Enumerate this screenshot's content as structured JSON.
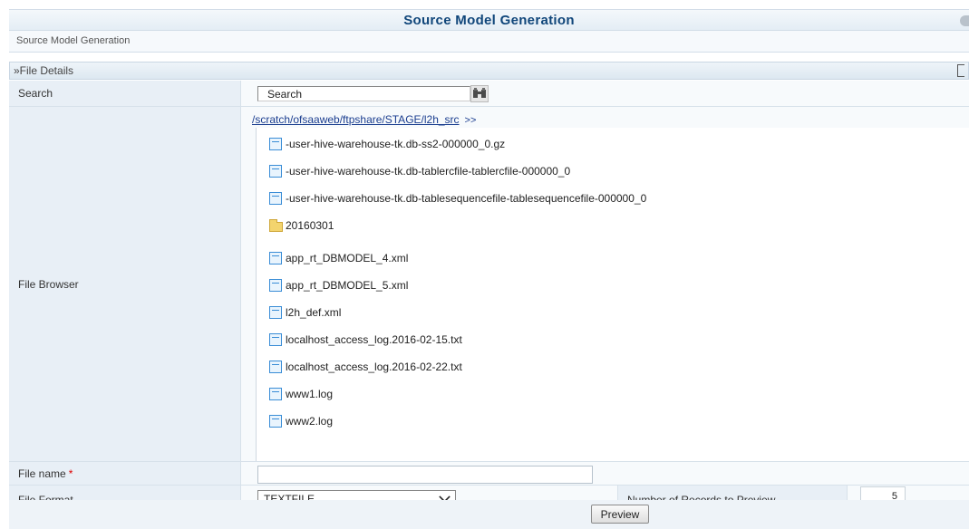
{
  "header": {
    "title": "Source Model Generation"
  },
  "breadcrumb": "Source Model Generation",
  "section": {
    "title": "»File Details"
  },
  "form": {
    "search_label": "Search",
    "search_value": "Search",
    "browser_label": "File Browser",
    "path": "/scratch/ofsaaweb/ftpshare/STAGE/l2h_src",
    "path_more": ">>",
    "files": [
      {
        "name": "-user-hive-warehouse-tk.db-ss2-000000_0.gz",
        "type": "file"
      },
      {
        "name": "-user-hive-warehouse-tk.db-tablercfile-tablercfile-000000_0",
        "type": "file"
      },
      {
        "name": "-user-hive-warehouse-tk.db-tablesequencefile-tablesequencefile-000000_0",
        "type": "file"
      },
      {
        "name": "20160301",
        "type": "folder"
      },
      {
        "name": "app_rt_DBMODEL_4.xml",
        "type": "file"
      },
      {
        "name": "app_rt_DBMODEL_5.xml",
        "type": "file"
      },
      {
        "name": "l2h_def.xml",
        "type": "file"
      },
      {
        "name": "localhost_access_log.2016-02-15.txt",
        "type": "file"
      },
      {
        "name": "localhost_access_log.2016-02-22.txt",
        "type": "file"
      },
      {
        "name": "www1.log",
        "type": "file"
      },
      {
        "name": "www2.log",
        "type": "file"
      }
    ],
    "filename_label": "File name",
    "required_mark": "*",
    "filename_value": "",
    "format_label": "File Format",
    "format_value": "TEXTFILE",
    "records_label": "Number of Records to Preview",
    "records_value": "5"
  },
  "buttons": {
    "preview": "Preview"
  }
}
